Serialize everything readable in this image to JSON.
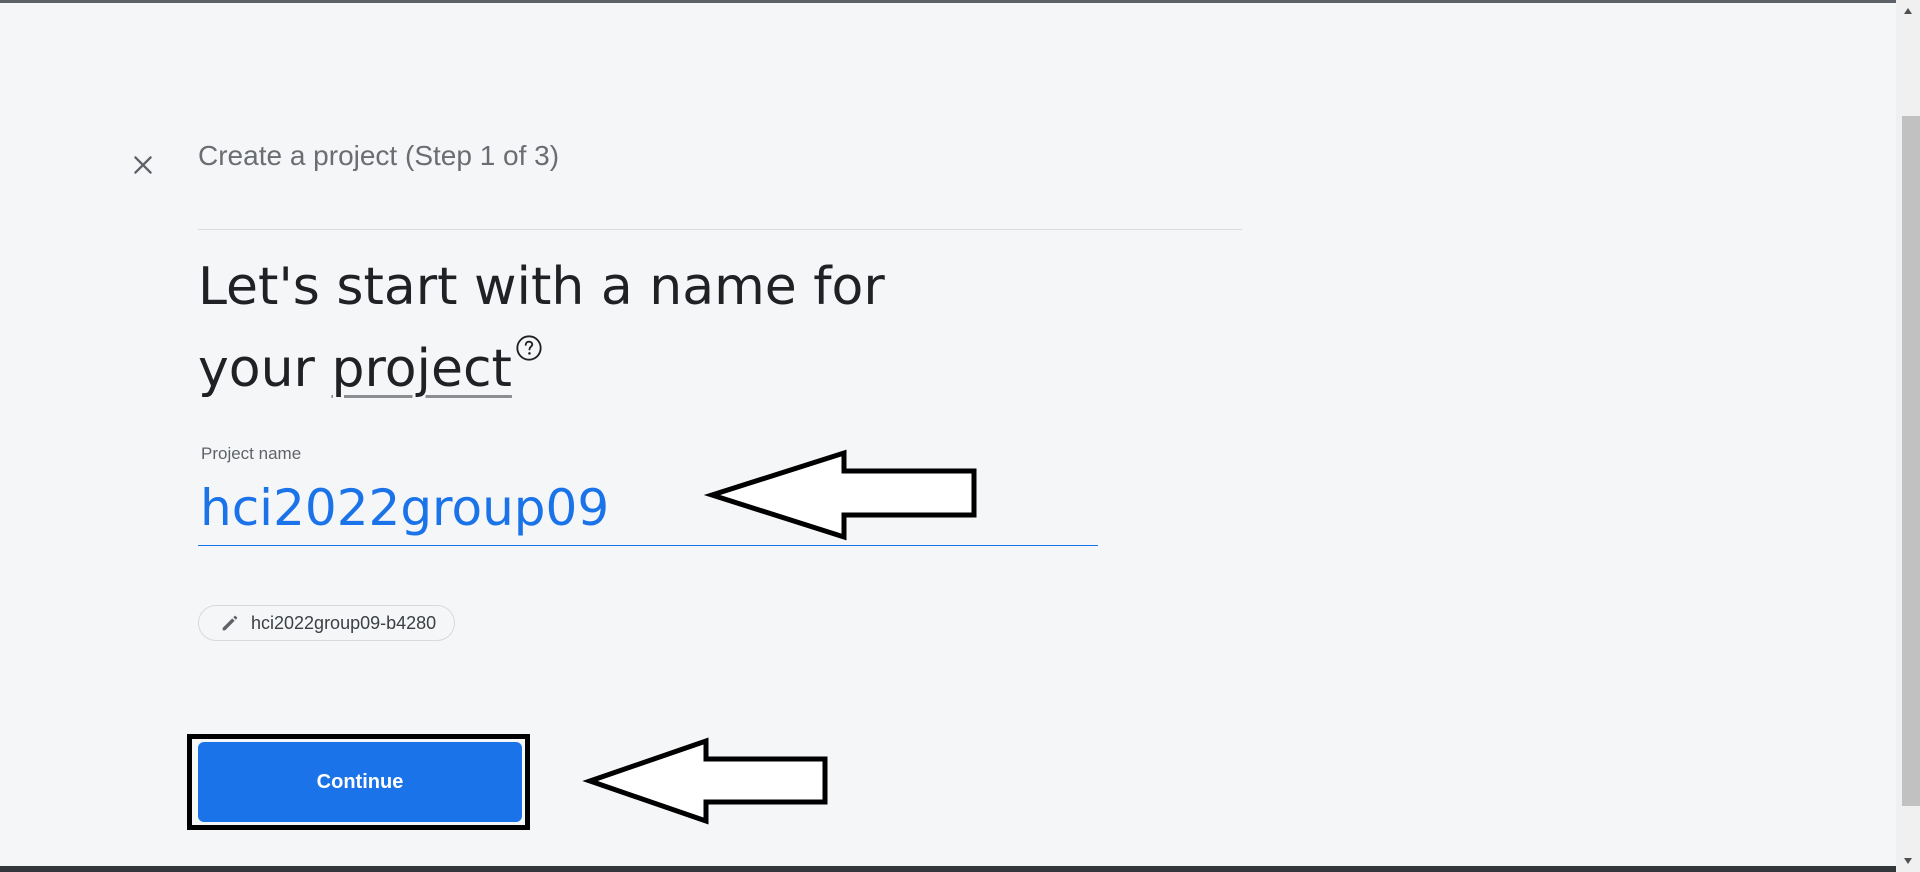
{
  "dialog": {
    "step_title": "Create a project (Step 1 of 3)",
    "heading_prefix": "Let's start with a name for your ",
    "heading_term": "project",
    "help_icon": "help-circle-icon",
    "close_icon": "close-icon"
  },
  "form": {
    "project_name_label": "Project name",
    "project_name_value": "hci2022group09",
    "project_id": "hci2022group09-b4280",
    "edit_icon": "pencil-icon"
  },
  "actions": {
    "continue_label": "Continue"
  },
  "colors": {
    "accent": "#1a73e8",
    "background": "#f5f6f8",
    "text_primary": "#202124",
    "text_secondary": "#6a6d71"
  }
}
